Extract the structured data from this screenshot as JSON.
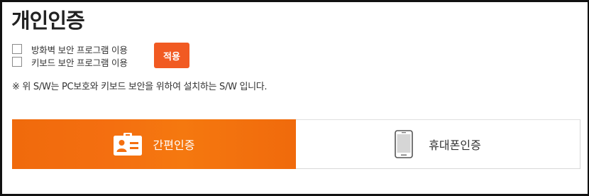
{
  "page": {
    "title": "개인인증"
  },
  "security_options": [
    {
      "label": "방화벽 보안 프로그램 이용",
      "checked": false
    },
    {
      "label": "키보드 보안 프로그램 이용",
      "checked": false
    }
  ],
  "apply_button": {
    "label": "적용"
  },
  "notice": "※ 위 S/W는 PC보호와 키보드 보안을 위하여 설치하는 S/W 입니다.",
  "tabs": [
    {
      "label": "간편인증",
      "icon": "id-card-icon",
      "active": true
    },
    {
      "label": "휴대폰인증",
      "icon": "mobile-phone-icon",
      "active": false
    }
  ],
  "colors": {
    "accent": "#f15a22",
    "active_tab": "#f46f10"
  }
}
